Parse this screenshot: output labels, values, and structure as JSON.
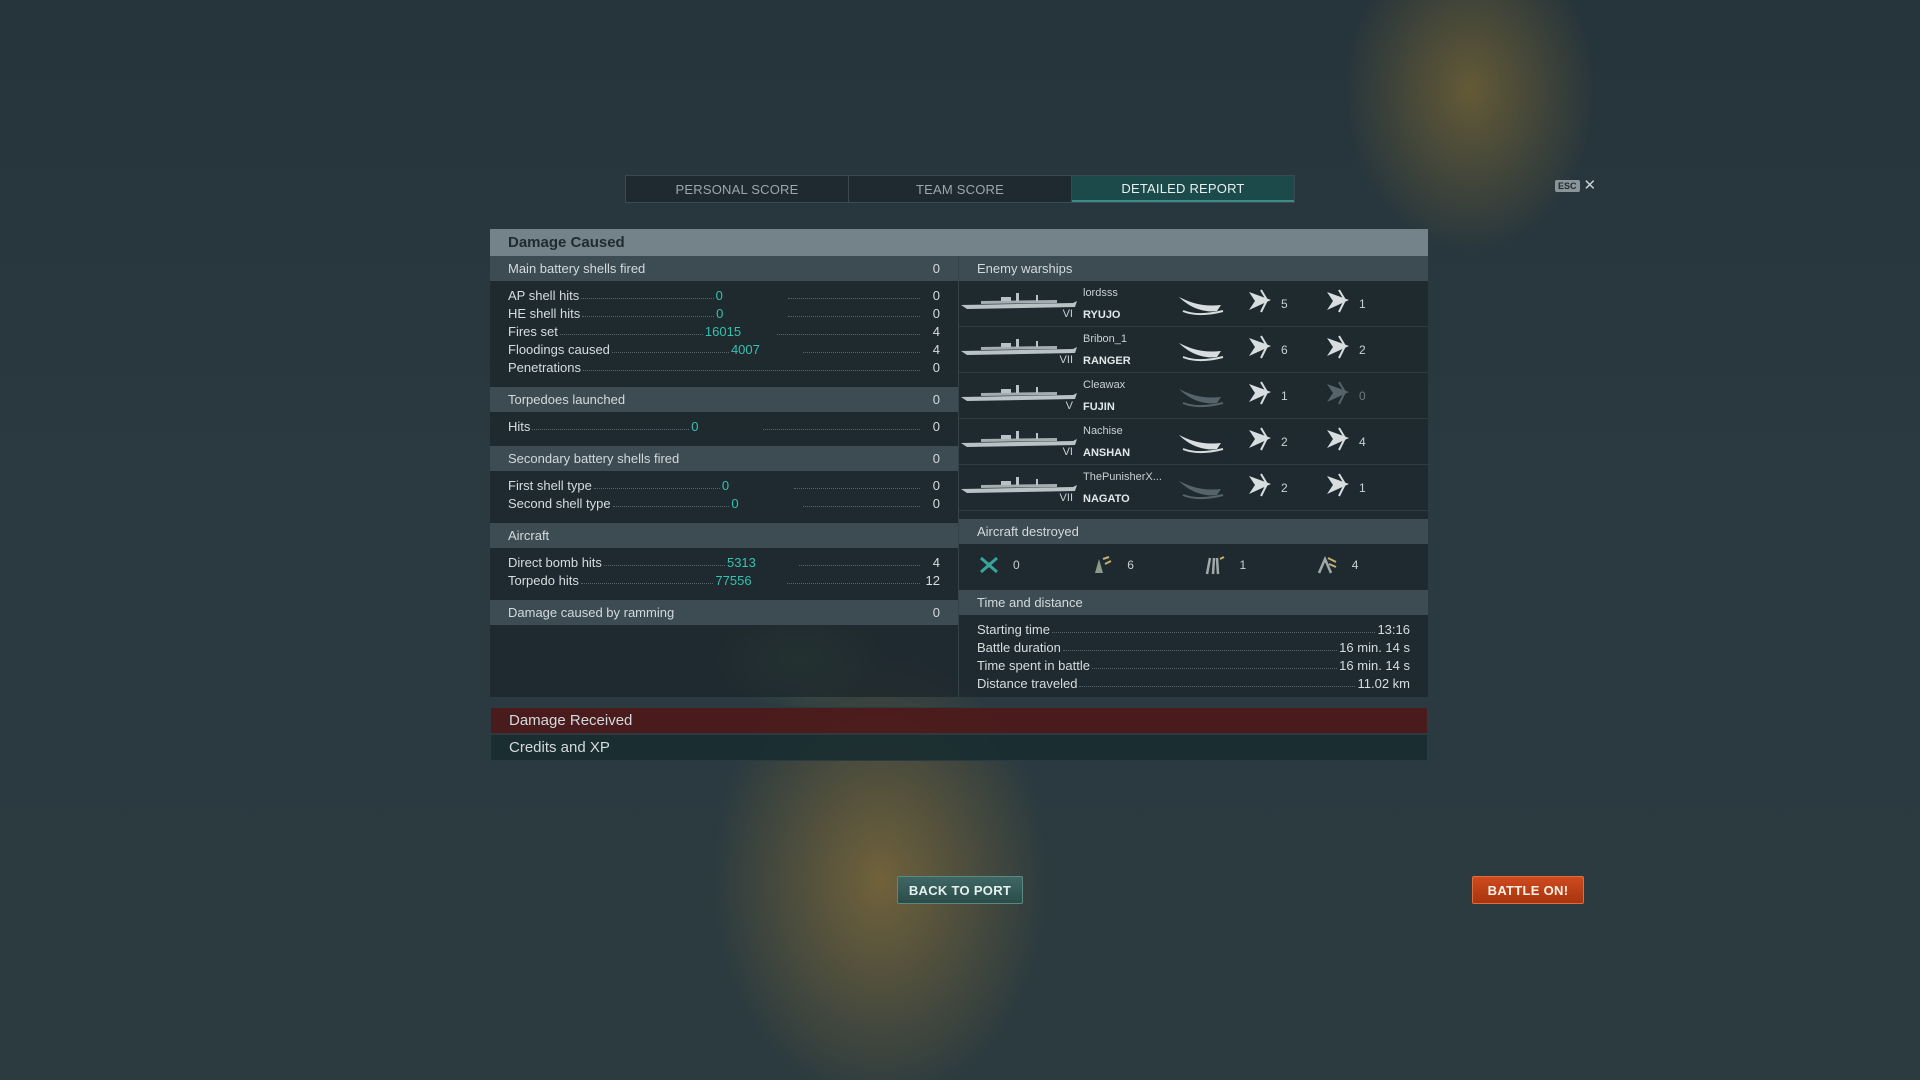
{
  "tabs": [
    {
      "label": "PERSONAL SCORE",
      "active": false
    },
    {
      "label": "TEAM SCORE",
      "active": false
    },
    {
      "label": "DETAILED REPORT",
      "active": true
    }
  ],
  "esc": {
    "key": "ESC",
    "close_icon": "close-icon"
  },
  "damage_caused": {
    "title": "Damage Caused",
    "main_battery": {
      "label": "Main battery shells fired",
      "value": "0",
      "rows": [
        {
          "label": "AP shell hits",
          "damage": "0",
          "count": "0"
        },
        {
          "label": "HE shell hits",
          "damage": "0",
          "count": "0"
        },
        {
          "label": "Fires set",
          "damage": "16015",
          "count": "4"
        },
        {
          "label": "Floodings caused",
          "damage": "4007",
          "count": "4"
        },
        {
          "label": "Penetrations",
          "damage": "",
          "count": "0"
        }
      ]
    },
    "torpedoes": {
      "label": "Torpedoes launched",
      "value": "0",
      "rows": [
        {
          "label": "Hits",
          "damage": "0",
          "count": "0"
        }
      ]
    },
    "secondary": {
      "label": "Secondary battery shells fired",
      "value": "0",
      "rows": [
        {
          "label": "First shell type",
          "damage": "0",
          "count": "0"
        },
        {
          "label": "Second shell type",
          "damage": "0",
          "count": "0"
        }
      ]
    },
    "aircraft": {
      "label": "Aircraft",
      "rows": [
        {
          "label": "Direct bomb hits",
          "damage": "5313",
          "count": "4"
        },
        {
          "label": "Torpedo hits",
          "damage": "77556",
          "count": "12"
        }
      ]
    },
    "ramming": {
      "label": "Damage caused by ramming",
      "value": "0"
    }
  },
  "enemy_warships": {
    "label": "Enemy warships",
    "ships": [
      {
        "player": "lordsss",
        "ship": "RYUJO",
        "tier": "VI",
        "stat1": "5",
        "stat2": "1",
        "sunk_active": true,
        "stat2_dim": false
      },
      {
        "player": "Bribon_1",
        "ship": "RANGER",
        "tier": "VII",
        "stat1": "6",
        "stat2": "2",
        "sunk_active": true,
        "stat2_dim": false
      },
      {
        "player": "Cleawax",
        "ship": "FUJIN",
        "tier": "V",
        "stat1": "1",
        "stat2": "0",
        "sunk_active": false,
        "stat2_dim": true
      },
      {
        "player": "Nachise",
        "ship": "ANSHAN",
        "tier": "VI",
        "stat1": "2",
        "stat2": "4",
        "sunk_active": true,
        "stat2_dim": false
      },
      {
        "player": "ThePunisherX...",
        "ship": "NAGATO",
        "tier": "VII",
        "stat1": "2",
        "stat2": "1",
        "sunk_active": false,
        "stat2_dim": false
      }
    ]
  },
  "aircraft_destroyed": {
    "label": "Aircraft destroyed",
    "items": [
      {
        "icon": "fighter-icon",
        "value": "0"
      },
      {
        "icon": "torpedo-bomber-icon",
        "value": "6"
      },
      {
        "icon": "dive-bomber-icon",
        "value": "1"
      },
      {
        "icon": "catapult-fighter-icon",
        "value": "4"
      }
    ]
  },
  "time_distance": {
    "label": "Time and distance",
    "rows": [
      {
        "label": "Starting time",
        "value": "13:16"
      },
      {
        "label": "Battle duration",
        "value": "16 min. 14 s"
      },
      {
        "label": "Time spent in battle",
        "value": "16 min. 14 s"
      },
      {
        "label": "Distance traveled",
        "value": "11.02 km"
      }
    ]
  },
  "bars": {
    "damage_received": "Damage Received",
    "credits_xp": "Credits and XP"
  },
  "buttons": {
    "back": "BACK TO PORT",
    "battle": "BATTLE ON!"
  },
  "colors": {
    "accent": "#35c0b0",
    "battle_button": "#c2441a",
    "back_button": "#355b57"
  }
}
